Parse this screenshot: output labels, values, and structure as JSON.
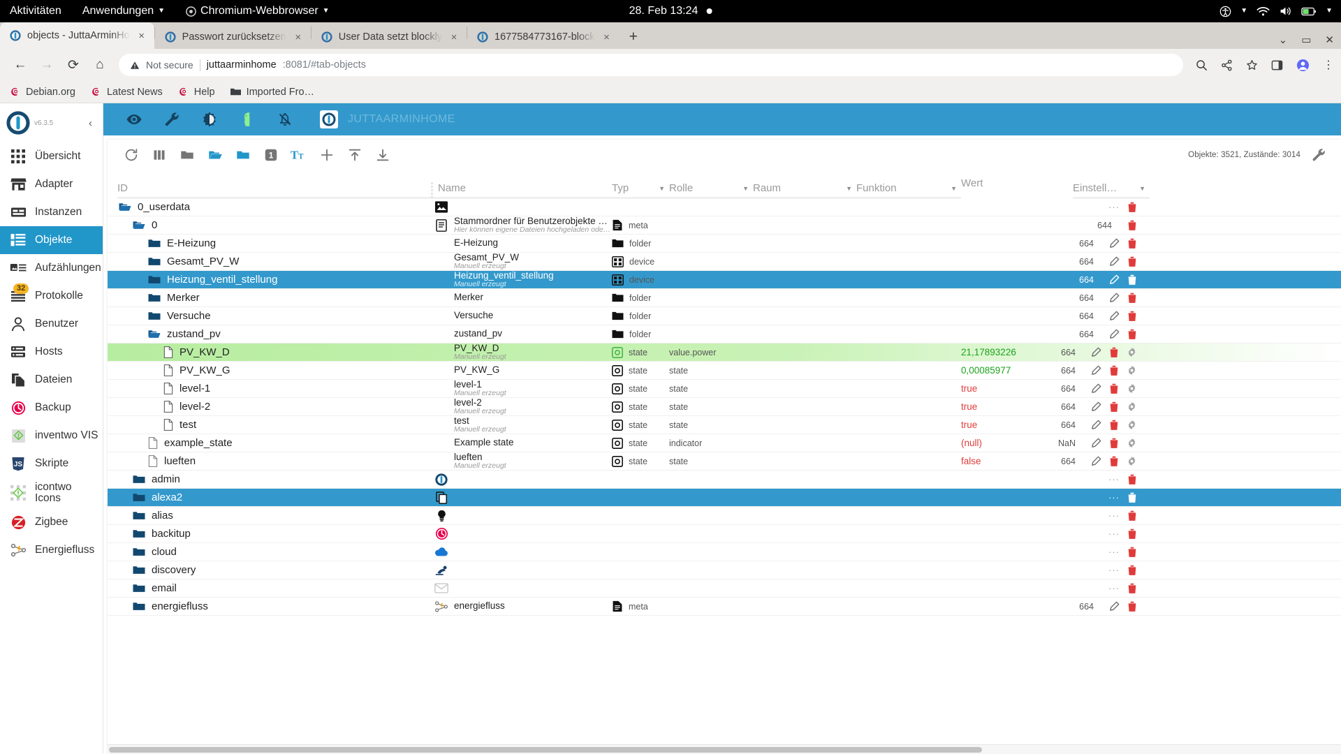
{
  "desktop": {
    "activities": "Aktivitäten",
    "applications": "Anwendungen",
    "browser_menu": "Chromium-Webbrowser",
    "clock": "28. Feb  13:24"
  },
  "browser": {
    "tabs": [
      {
        "label": "objects - JuttaArminHo",
        "active": true,
        "close": "×"
      },
      {
        "label": "Passwort zurücksetzen",
        "active": false,
        "close": "×"
      },
      {
        "label": "User Data setzt blockly",
        "active": false,
        "close": "×"
      },
      {
        "label": "1677584773167-block",
        "active": false,
        "close": "×"
      }
    ],
    "new_tab": "+",
    "omnibox": {
      "security_label": "Not secure",
      "url_host": "juttaarminhome",
      "url_rest": ":8081/#tab-objects"
    },
    "bookmarks": [
      {
        "label": "Debian.org",
        "icon": "debian-icon"
      },
      {
        "label": "Latest News",
        "icon": "debian-icon"
      },
      {
        "label": "Help",
        "icon": "debian-icon"
      },
      {
        "label": "Imported Fro…",
        "icon": "folder-icon"
      }
    ]
  },
  "sidebar": {
    "version": "v6.3.5",
    "items": [
      {
        "label": "Übersicht",
        "icon": "grid-icon",
        "active": false
      },
      {
        "label": "Adapter",
        "icon": "store-icon",
        "active": false
      },
      {
        "label": "Instanzen",
        "icon": "server-icon",
        "active": false
      },
      {
        "label": "Objekte",
        "icon": "list-icon",
        "active": true
      },
      {
        "label": "Aufzählungen",
        "icon": "enum-icon",
        "active": false
      },
      {
        "label": "Protokolle",
        "icon": "log-icon",
        "active": false,
        "badge": "32"
      },
      {
        "label": "Benutzer",
        "icon": "user-icon",
        "active": false
      },
      {
        "label": "Hosts",
        "icon": "hosts-icon",
        "active": false
      },
      {
        "label": "Dateien",
        "icon": "files-icon",
        "active": false
      },
      {
        "label": "Backup",
        "icon": "backup-icon",
        "active": false
      },
      {
        "label": "inventwo VIS",
        "icon": "inventwo-icon",
        "active": false
      },
      {
        "label": "Skripte",
        "icon": "js-icon",
        "active": false
      },
      {
        "label": "icontwo Icons",
        "icon": "icontwo-icon",
        "active": false
      },
      {
        "label": "Zigbee",
        "icon": "zigbee-icon",
        "active": false
      },
      {
        "label": "Energiefluss",
        "icon": "energy-icon",
        "active": false
      }
    ]
  },
  "appbar": {
    "host_name": "JUTTAARMINHOME",
    "icons": [
      "eye-icon",
      "wrench-icon",
      "contrast-icon",
      "green-head-icon",
      "bell-off-icon"
    ]
  },
  "objects_toolbar": {
    "buttons": [
      "refresh-icon",
      "columns-icon",
      "folder-closed-icon",
      "folder-open-icon",
      "folder-blue-icon",
      "expand-level-1-icon",
      "text-size-icon",
      "add-icon",
      "upload-icon",
      "download-icon"
    ],
    "expand_level": "1",
    "stats": "Objekte: 3521, Zustände: 3014",
    "settings_icon": "wrench-icon"
  },
  "table": {
    "headers": {
      "id": "ID",
      "name": "Name",
      "typ": "Typ",
      "rolle": "Rolle",
      "raum": "Raum",
      "funktion": "Funktion",
      "wert": "Wert",
      "einstellungen": "Einstell…"
    },
    "rows": [
      {
        "id": "0_userdata",
        "indent": 0,
        "icon": "folder-open-blue",
        "name": "",
        "sub": "",
        "nameicon": "image-icon",
        "typ": "",
        "rolle": "",
        "wert": "",
        "perm": "",
        "dots": "···",
        "tools": [
          "trash"
        ]
      },
      {
        "id": "0",
        "indent": 1,
        "icon": "folder-open-blue",
        "name": "Stammordner für Benutzerobjekte und Dateien",
        "sub": "Hier können eigene Dateien hochgeladen oder private Objekte und Zustän",
        "nameicon": "doc-icon",
        "typ": "meta",
        "typicon": "meta-icon",
        "rolle": "",
        "wert": "",
        "perm": "644",
        "dots": "",
        "tools": [
          "trash"
        ]
      },
      {
        "id": "E-Heizung",
        "indent": 2,
        "icon": "folder-blue",
        "name": "E-Heizung",
        "sub": "",
        "typ": "folder",
        "typicon": "folder-dark-icon",
        "rolle": "",
        "wert": "",
        "perm": "664",
        "tools": [
          "pencil",
          "trash"
        ]
      },
      {
        "id": "Gesamt_PV_W",
        "indent": 2,
        "icon": "folder-blue",
        "name": "Gesamt_PV_W",
        "sub": "Manuell erzeugt",
        "typ": "device",
        "typicon": "device-icon",
        "rolle": "",
        "wert": "",
        "perm": "664",
        "tools": [
          "pencil",
          "trash"
        ]
      },
      {
        "id": "Heizung_ventil_stellung",
        "indent": 2,
        "icon": "folder-blue",
        "name": "Heizung_ventil_stellung",
        "sub": "Manuell erzeugt",
        "typ": "device",
        "typicon": "device-icon",
        "rolle": "",
        "wert": "",
        "perm": "664",
        "selected": true,
        "tools": [
          "pencil",
          "trash"
        ]
      },
      {
        "id": "Merker",
        "indent": 2,
        "icon": "folder-blue",
        "name": "Merker",
        "sub": "",
        "typ": "folder",
        "typicon": "folder-dark-icon",
        "rolle": "",
        "wert": "",
        "perm": "664",
        "tools": [
          "pencil",
          "trash"
        ]
      },
      {
        "id": "Versuche",
        "indent": 2,
        "icon": "folder-blue",
        "name": "Versuche",
        "sub": "",
        "typ": "folder",
        "typicon": "folder-dark-icon",
        "rolle": "",
        "wert": "",
        "perm": "664",
        "tools": [
          "pencil",
          "trash"
        ]
      },
      {
        "id": "zustand_pv",
        "indent": 2,
        "icon": "folder-open-blue",
        "name": "zustand_pv",
        "sub": "",
        "typ": "folder",
        "typicon": "folder-dark-icon",
        "rolle": "",
        "wert": "",
        "perm": "664",
        "tools": [
          "pencil",
          "trash"
        ]
      },
      {
        "id": "PV_KW_D",
        "indent": 3,
        "icon": "state-doc",
        "name": "PV_KW_D",
        "sub": "Manuell erzeugt",
        "typ": "state",
        "typicon": "state-green-icon",
        "rolle": "value.power",
        "wert": "21,17893226",
        "wertcolor": "green",
        "perm": "664",
        "highlight": true,
        "tools": [
          "pencil",
          "trash",
          "gear"
        ]
      },
      {
        "id": "PV_KW_G",
        "indent": 3,
        "icon": "state-doc",
        "name": "PV_KW_G",
        "sub": "",
        "typ": "state",
        "typicon": "state-icon",
        "rolle": "state",
        "wert": "0,00085977",
        "wertcolor": "green",
        "perm": "664",
        "tools": [
          "pencil",
          "trash",
          "gear"
        ]
      },
      {
        "id": "level-1",
        "indent": 3,
        "icon": "state-doc",
        "name": "level-1",
        "sub": "Manuell erzeugt",
        "typ": "state",
        "typicon": "state-icon",
        "rolle": "state",
        "wert": "true",
        "wertcolor": "red",
        "perm": "664",
        "tools": [
          "pencil",
          "trash",
          "gear"
        ]
      },
      {
        "id": "level-2",
        "indent": 3,
        "icon": "state-doc",
        "name": "level-2",
        "sub": "Manuell erzeugt",
        "typ": "state",
        "typicon": "state-icon",
        "rolle": "state",
        "wert": "true",
        "wertcolor": "red",
        "perm": "664",
        "tools": [
          "pencil",
          "trash",
          "gear"
        ]
      },
      {
        "id": "test",
        "indent": 3,
        "icon": "state-doc",
        "name": "test",
        "sub": "Manuell erzeugt",
        "typ": "state",
        "typicon": "state-icon",
        "rolle": "state",
        "wert": "true",
        "wertcolor": "red",
        "perm": "664",
        "tools": [
          "pencil",
          "trash",
          "gear"
        ]
      },
      {
        "id": "example_state",
        "indent": 2,
        "icon": "state-doc-gray",
        "name": "Example state",
        "sub": "",
        "typ": "state",
        "typicon": "state-icon",
        "rolle": "indicator",
        "wert": "(null)",
        "wertcolor": "red",
        "perm": "NaN",
        "tools": [
          "pencil",
          "trash",
          "gear"
        ]
      },
      {
        "id": "lueften",
        "indent": 2,
        "icon": "state-doc-gray",
        "name": "lueften",
        "sub": "Manuell erzeugt",
        "typ": "state",
        "typicon": "state-icon",
        "rolle": "state",
        "wert": "false",
        "wertcolor": "red",
        "perm": "664",
        "tools": [
          "pencil",
          "trash",
          "gear"
        ]
      },
      {
        "id": "admin",
        "indent": 1,
        "icon": "folder-blue",
        "name": "",
        "sub": "",
        "nameicon": "iob-icon",
        "typ": "",
        "rolle": "",
        "wert": "",
        "perm": "",
        "dots": "···",
        "tools": [
          "trash"
        ]
      },
      {
        "id": "alexa2",
        "indent": 1,
        "icon": "folder-blue",
        "name": "",
        "sub": "",
        "nameicon": "copy-icon",
        "typ": "",
        "rolle": "",
        "wert": "",
        "perm": "",
        "dots": "···",
        "selected": true,
        "tools": [
          "trash"
        ]
      },
      {
        "id": "alias",
        "indent": 1,
        "icon": "folder-blue",
        "name": "",
        "sub": "",
        "nameicon": "bulb-icon",
        "typ": "",
        "rolle": "",
        "wert": "",
        "perm": "",
        "dots": "···",
        "tools": [
          "trash"
        ]
      },
      {
        "id": "backitup",
        "indent": 1,
        "icon": "folder-blue",
        "name": "",
        "sub": "",
        "nameicon": "backup-icon",
        "typ": "",
        "rolle": "",
        "wert": "",
        "perm": "",
        "dots": "···",
        "tools": [
          "trash"
        ]
      },
      {
        "id": "cloud",
        "indent": 1,
        "icon": "folder-blue",
        "name": "",
        "sub": "",
        "nameicon": "cloud-icon",
        "typ": "",
        "rolle": "",
        "wert": "",
        "perm": "",
        "dots": "···",
        "tools": [
          "trash"
        ]
      },
      {
        "id": "discovery",
        "indent": 1,
        "icon": "folder-blue",
        "name": "",
        "sub": "",
        "nameicon": "discovery-icon",
        "typ": "",
        "rolle": "",
        "wert": "",
        "perm": "",
        "dots": "···",
        "tools": [
          "trash"
        ]
      },
      {
        "id": "email",
        "indent": 1,
        "icon": "folder-blue",
        "name": "",
        "sub": "",
        "nameicon": "mail-icon",
        "typ": "",
        "rolle": "",
        "wert": "",
        "perm": "",
        "dots": "···",
        "tools": [
          "trash"
        ]
      },
      {
        "id": "energiefluss",
        "indent": 1,
        "icon": "folder-blue",
        "name": "energiefluss",
        "sub": "",
        "nameicon": "energy-icon",
        "typ": "meta",
        "typicon": "meta-icon",
        "rolle": "",
        "wert": "",
        "perm": "664",
        "tools": [
          "pencil",
          "trash"
        ]
      }
    ]
  }
}
